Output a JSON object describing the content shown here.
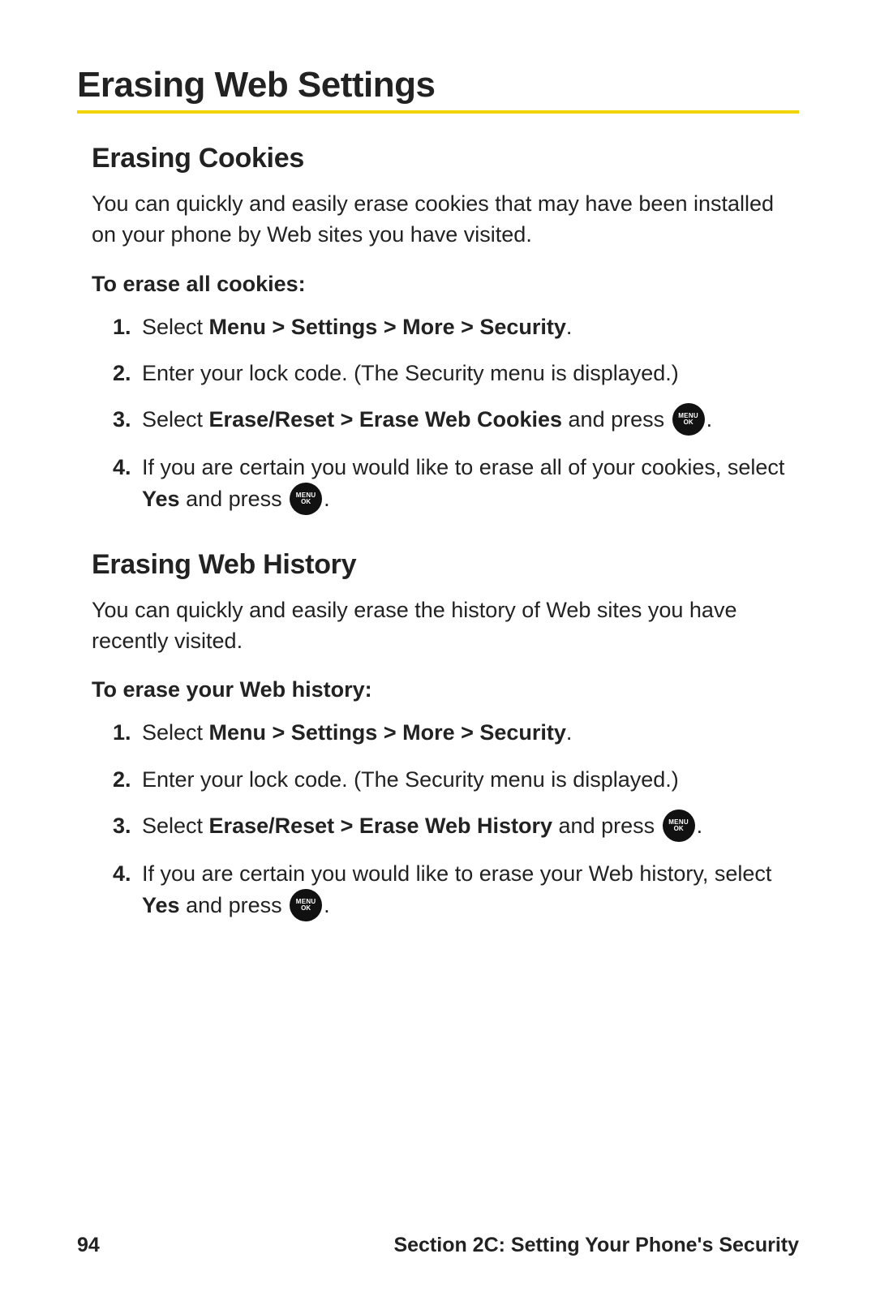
{
  "page_title": "Erasing Web Settings",
  "icon": {
    "line1": "MENU",
    "line2": "OK"
  },
  "sections": [
    {
      "heading": "Erasing Cookies",
      "intro": "You can quickly and easily erase cookies that may have been installed on your phone by Web sites you have visited.",
      "procedure_label": "To erase all cookies:",
      "steps": {
        "s1_pre": "Select ",
        "s1_bold": "Menu > Settings > More > Security",
        "s1_post": ".",
        "s2": "Enter your lock code. (The Security menu is displayed.)",
        "s3_pre": "Select ",
        "s3_bold": "Erase/Reset > Erase Web Cookies",
        "s3_mid": " and press ",
        "s3_post": ".",
        "s4_pre": "If you are certain you would like to erase all of your cookies, select ",
        "s4_bold": "Yes",
        "s4_mid": " and press ",
        "s4_post": "."
      }
    },
    {
      "heading": "Erasing Web History",
      "intro": "You can quickly and easily erase the history of Web sites you have recently visited.",
      "procedure_label": "To erase your Web history:",
      "steps": {
        "s1_pre": "Select ",
        "s1_bold": "Menu > Settings > More > Security",
        "s1_post": ".",
        "s2": "Enter your lock code. (The Security menu is displayed.)",
        "s3_pre": "Select ",
        "s3_bold": "Erase/Reset > Erase Web History",
        "s3_mid": " and press ",
        "s3_post": ".",
        "s4_pre": "If you are certain you would like to erase your Web history, select ",
        "s4_bold": "Yes",
        "s4_mid": " and press ",
        "s4_post": "."
      }
    }
  ],
  "footer": {
    "page_number": "94",
    "section_label": "Section 2C: Setting Your Phone's Security"
  }
}
